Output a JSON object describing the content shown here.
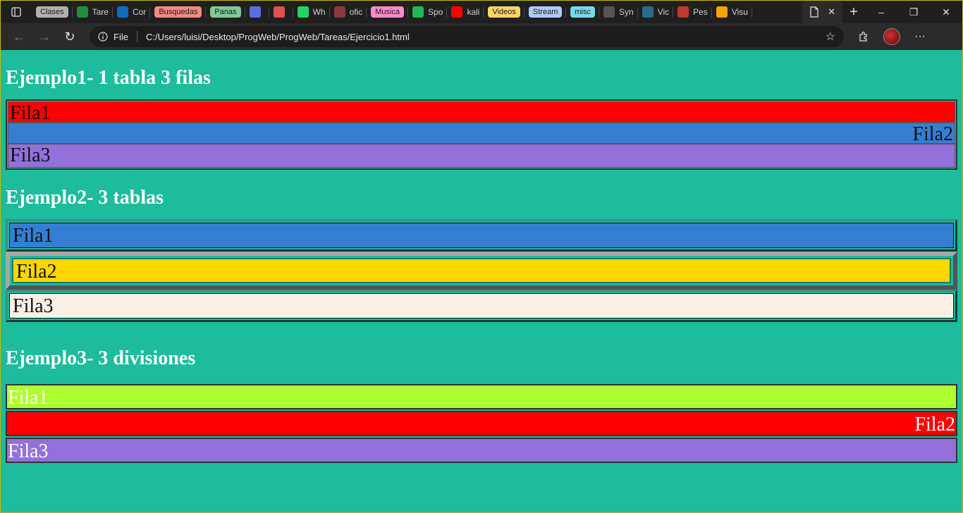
{
  "browser": {
    "tabs": [
      {
        "type": "group",
        "label": "Clases",
        "color": "#b0b0b0"
      },
      {
        "type": "tab",
        "title": "Tare",
        "icon": "classroom-icon",
        "color": "#1e8e3e"
      },
      {
        "type": "tab",
        "title": "Cor",
        "icon": "outlook-icon",
        "color": "#0f6cbd"
      },
      {
        "type": "group",
        "label": "Busquedas",
        "color": "#f28b82"
      },
      {
        "type": "group",
        "label": "Panas",
        "color": "#81c995"
      },
      {
        "type": "tab",
        "title": "",
        "icon": "badge-icon",
        "color": "#5b6ee1"
      },
      {
        "type": "tab",
        "title": "",
        "icon": "record-icon",
        "color": "#e05050"
      },
      {
        "type": "tab",
        "title": "Wh",
        "icon": "whatsapp-icon",
        "color": "#25d366"
      },
      {
        "type": "tab",
        "title": "ofic",
        "icon": "pdf-icon",
        "color": "#8a3a3a"
      },
      {
        "type": "group",
        "label": "Musica",
        "color": "#ff8bcb"
      },
      {
        "type": "tab",
        "title": "Spo",
        "icon": "spotify-icon",
        "color": "#1db954"
      },
      {
        "type": "tab",
        "title": "kali",
        "icon": "youtube-icon",
        "color": "#ff0000"
      },
      {
        "type": "group",
        "label": "Videos",
        "color": "#fdd663"
      },
      {
        "type": "group",
        "label": "Stream",
        "color": "#aecbfa"
      },
      {
        "type": "group",
        "label": "misc",
        "color": "#78d9ec"
      },
      {
        "type": "tab",
        "title": "Syn",
        "icon": "file-icon",
        "color": "#555555"
      },
      {
        "type": "tab",
        "title": "Vic",
        "icon": "chart-icon",
        "color": "#2a6b8a"
      },
      {
        "type": "tab",
        "title": "Pes",
        "icon": "flag-icon",
        "color": "#c0392b"
      },
      {
        "type": "tab",
        "title": "Visu",
        "icon": "stack-icon",
        "color": "#f4a300"
      }
    ],
    "active_tab_icon": "file-icon",
    "address": {
      "scheme_label": "File",
      "url": "C:/Users/luisi/Desktop/ProgWeb/ProgWeb/Tareas/Ejercicio1.html"
    }
  },
  "page": {
    "ej1": {
      "title": "Ejemplo1- 1 tabla 3 filas",
      "rows": [
        "Fila1",
        "Fila2",
        "Fila3"
      ]
    },
    "ej2": {
      "title": "Ejemplo2- 3 tablas",
      "rows": [
        "Fila1",
        "Fila2",
        "Fila3"
      ]
    },
    "ej3": {
      "title": "Ejemplo3- 3 divisiones",
      "rows": [
        "Fila1",
        "Fila2",
        "Fila3"
      ]
    }
  }
}
